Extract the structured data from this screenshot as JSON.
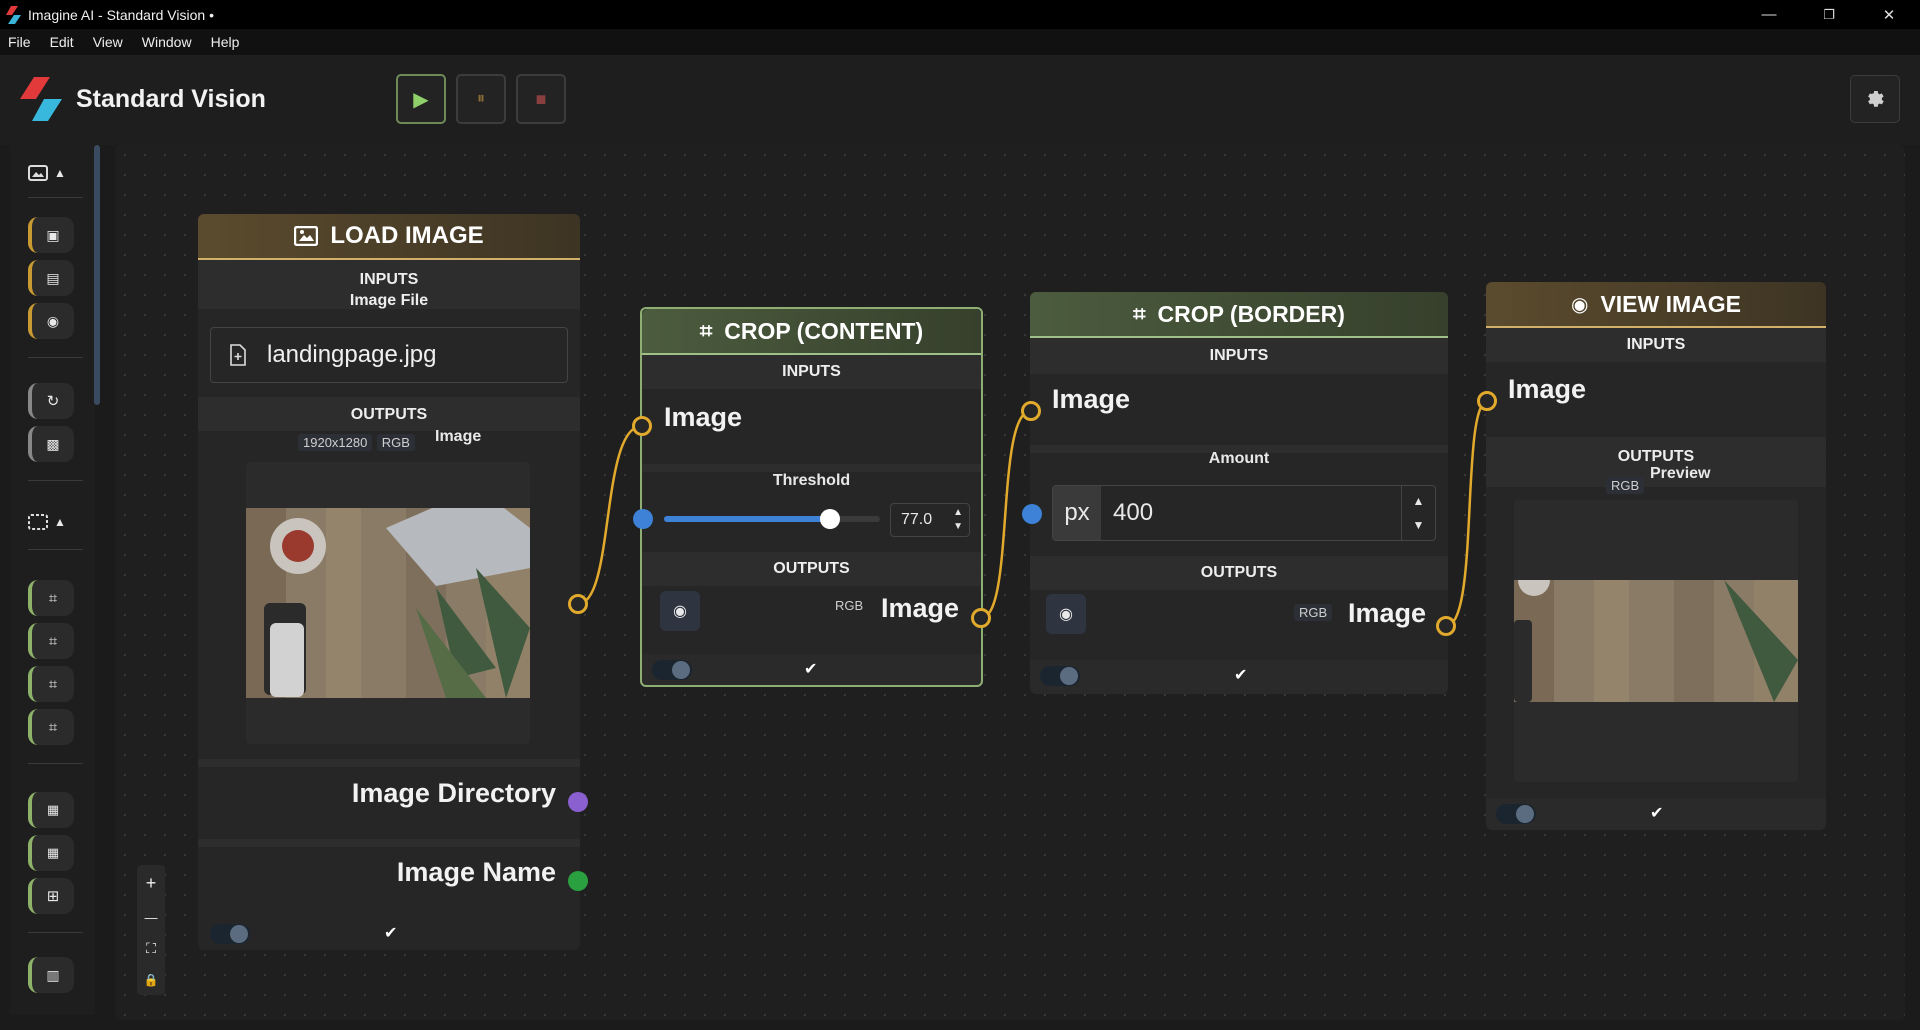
{
  "window": {
    "title": "Imagine AI - Standard Vision •",
    "minimize": "—",
    "restore": "❐",
    "close": "✕"
  },
  "menu": [
    "File",
    "Edit",
    "View",
    "Window",
    "Help"
  ],
  "app": {
    "name": "Standard Vision"
  },
  "toolbar": {
    "play": "▶",
    "pause": "⏸",
    "stop": "■"
  },
  "zoom": {
    "in": "+",
    "out": "—",
    "fit": "⛶",
    "lock": "🔒"
  },
  "nodes": {
    "load_image": {
      "title": "LOAD IMAGE",
      "inputs_label": "INPUTS",
      "image_file_label": "Image File",
      "file_value": "landingpage.jpg",
      "outputs_label": "OUTPUTS",
      "resolution": "1920x1280",
      "color_mode": "RGB",
      "image_label": "Image",
      "dir_label": "Image Directory",
      "name_label": "Image Name"
    },
    "crop_content": {
      "title": "CROP (CONTENT)",
      "inputs_label": "INPUTS",
      "image_label": "Image",
      "threshold_label": "Threshold",
      "threshold_value": "77.0",
      "threshold_fraction": 0.77,
      "outputs_label": "OUTPUTS",
      "color_mode": "RGB",
      "out_label": "Image"
    },
    "crop_border": {
      "title": "CROP (BORDER)",
      "inputs_label": "INPUTS",
      "image_label": "Image",
      "amount_label": "Amount",
      "unit": "px",
      "amount_value": "400",
      "outputs_label": "OUTPUTS",
      "color_mode": "RGB",
      "out_label": "Image"
    },
    "view_image": {
      "title": "VIEW IMAGE",
      "inputs_label": "INPUTS",
      "image_label": "Image",
      "outputs_label": "OUTPUTS",
      "preview_label": "Preview",
      "color_mode": "RGB"
    }
  }
}
